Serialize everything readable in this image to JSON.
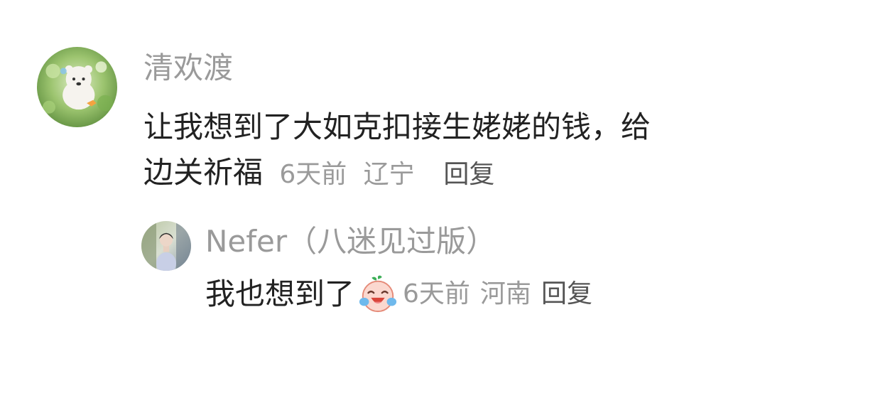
{
  "comment": {
    "username": "清欢渡",
    "text_line1": "让我想到了大如克扣接生姥姥的钱，给",
    "text_line2": "边关祈福",
    "time": "6天前",
    "location": "辽宁",
    "reply_label": "回复",
    "avatar_icon": "bear-avatar"
  },
  "reply": {
    "username": "Nefer（八迷见过版）",
    "text": "我也想到了",
    "emoji_icon": "crying-laughing-peach-emoji",
    "time": "6天前",
    "location": "河南",
    "reply_label": "回复",
    "avatar_icon": "person-avatar"
  },
  "colors": {
    "username": "#9a9a9a",
    "body": "#222222",
    "meta": "#9a9a9a",
    "reply": "#555555"
  }
}
